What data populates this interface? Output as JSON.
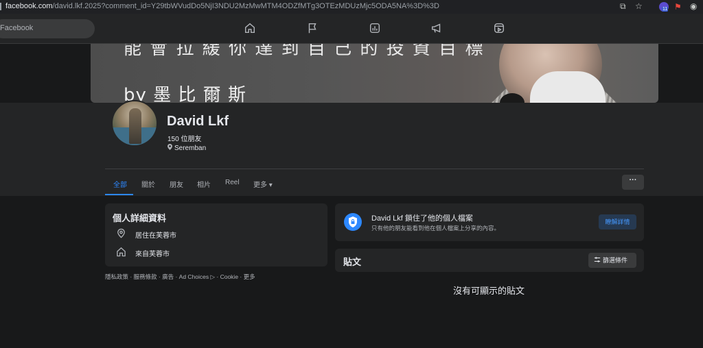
{
  "browser": {
    "url_host": "facebook.com",
    "url_path": "/david.lkf.2025?comment_id=Y29tbWVudDo5NjI3NDU2MzMwMTM4ODZfMTg3OTEzMDUzMjc5ODA5NA%3D%3D",
    "extension_badge": "11"
  },
  "topnav": {
    "search_placeholder": "Facebook",
    "icons": [
      "home-icon",
      "flag-icon",
      "marketplace-icon",
      "megaphone-icon",
      "video-icon"
    ]
  },
  "cover": {
    "line1": "能 會 拉 緩 你 達 到 自 己 的 投 資 目 標",
    "line2": "by 墨 比 爾 斯"
  },
  "profile": {
    "name": "David Lkf",
    "friends": "150 位朋友",
    "location": "Seremban"
  },
  "tabs": [
    {
      "label": "全部",
      "active": true
    },
    {
      "label": "關於"
    },
    {
      "label": "朋友"
    },
    {
      "label": "相片"
    },
    {
      "label": "Reel"
    },
    {
      "label": "更多 ▾"
    }
  ],
  "more_button": "···",
  "intro": {
    "title": "個人詳細資料",
    "lives_in": "居住在芙蓉市",
    "from": "來自芙蓉市"
  },
  "footer": "隱私政策 · 服務條款 · 廣告 · Ad Choices ▷ · Cookie · 更多",
  "locked": {
    "title": "David Lkf 鎖住了他的個人檔案",
    "subtitle": "只有他的朋友能看到他在個人檔案上分享的內容。",
    "button": "瞭解詳情"
  },
  "posts": {
    "title": "貼文",
    "filter": "篩選條件",
    "empty": "沒有可顯示的貼文"
  },
  "colors": {
    "accent": "#2d88ff",
    "background": "#18191a",
    "card": "#242526"
  }
}
